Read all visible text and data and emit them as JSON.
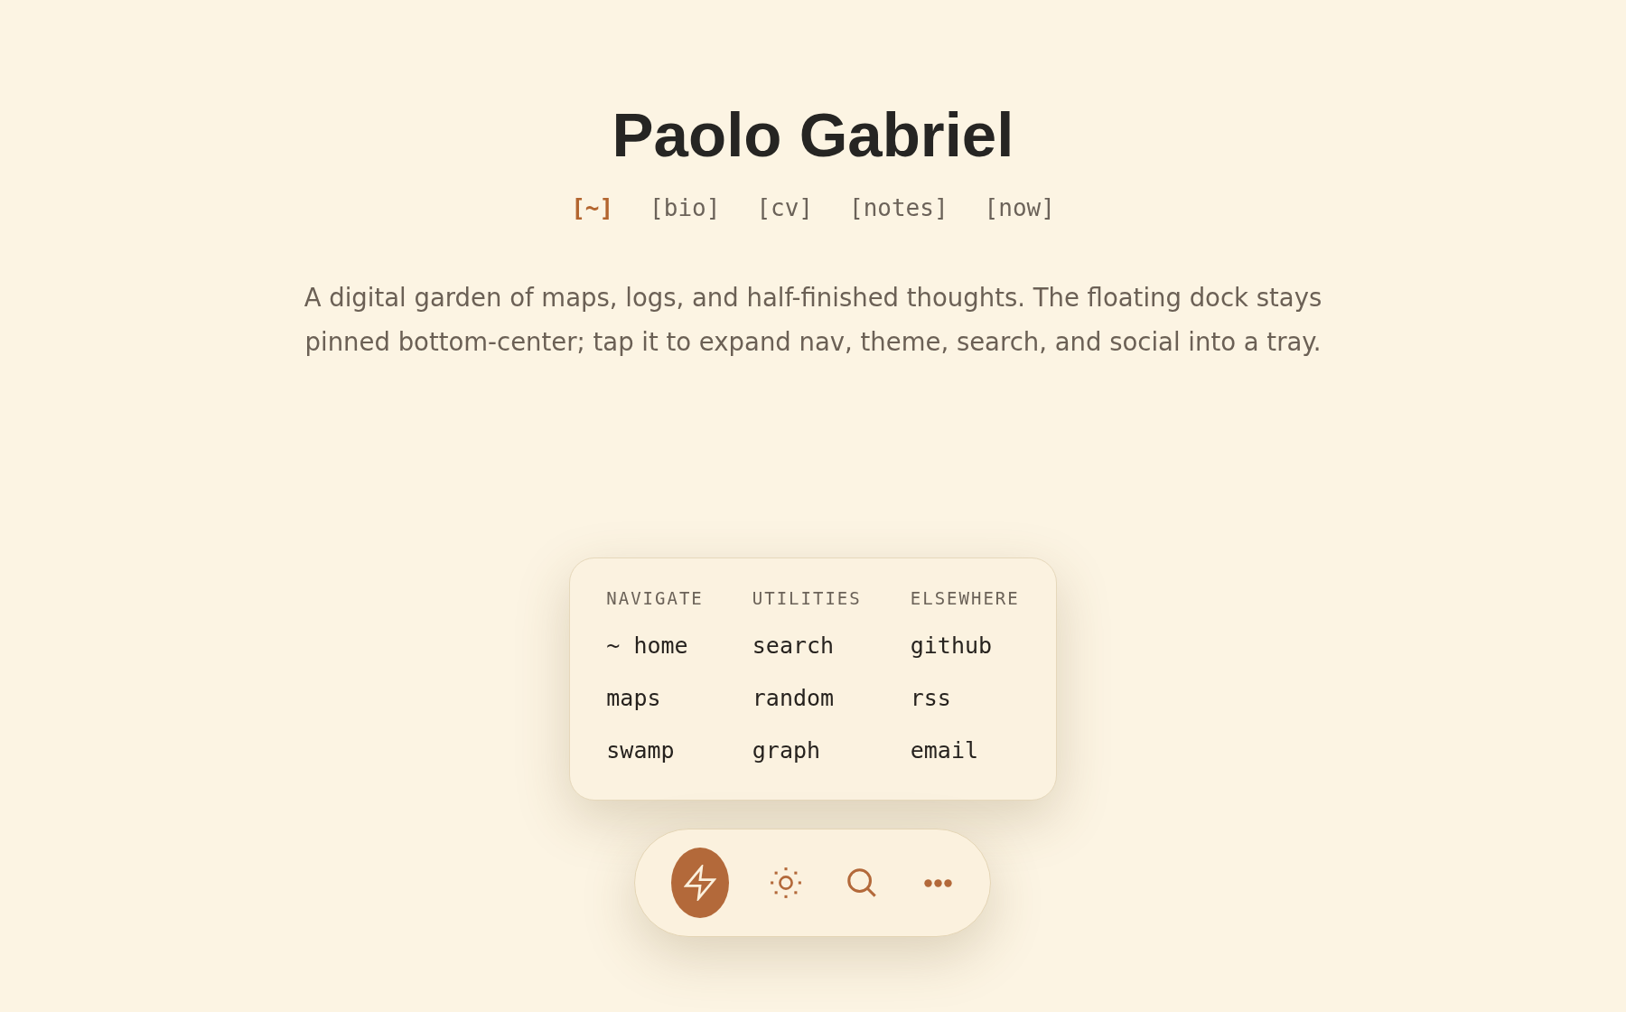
{
  "title": "Paolo Gabriel",
  "nav": [
    {
      "label": "[~]",
      "selected": true
    },
    {
      "label": "[bio]",
      "selected": false
    },
    {
      "label": "[cv]",
      "selected": false
    },
    {
      "label": "[notes]",
      "selected": false
    },
    {
      "label": "[now]",
      "selected": false
    }
  ],
  "intro": "A digital garden of maps, logs, and half-finished thoughts. The floating dock stays pinned bottom-center; tap it to expand nav, theme, search, and social into a tray.",
  "tray": {
    "columns": [
      {
        "heading": "NAVIGATE",
        "items": [
          "~ home",
          "maps",
          "swamp"
        ]
      },
      {
        "heading": "UTILITIES",
        "items": [
          "search",
          "random",
          "graph"
        ]
      },
      {
        "heading": "ELSEWHERE",
        "items": [
          "github",
          "rss",
          "email"
        ]
      }
    ]
  },
  "dock": {
    "buttons": [
      {
        "kind": "bolt",
        "selected": true
      },
      {
        "kind": "sun",
        "selected": false
      },
      {
        "kind": "search",
        "selected": false
      },
      {
        "kind": "more",
        "selected": false
      }
    ]
  }
}
